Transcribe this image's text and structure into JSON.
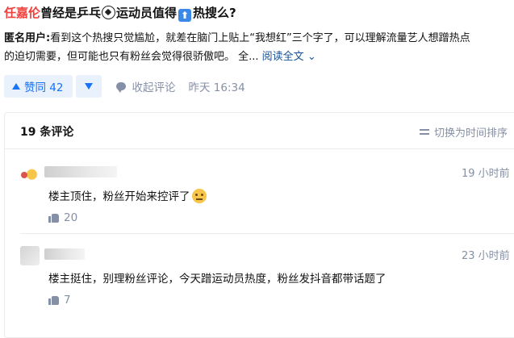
{
  "question": {
    "title_highlight": "任嘉伦",
    "title_part1": "曾经是乒乓",
    "icon_soccer": "soccer-ball-emoji",
    "title_part2": "运动员值得",
    "icon_up": "up-arrow-emoji",
    "title_part3": "热搜么?"
  },
  "answer": {
    "author": "匿名用户:",
    "text_line1": "看到这个热搜只觉尴尬，就差在脑门上贴上“我想红”三个字了，可以理解流量艺人想蹭热点",
    "text_line2": "的迫切需要，但可能也只有粉丝会觉得很骄傲吧。 全...",
    "read_more": "阅读全文",
    "read_more_icon": "chevron-down-icon"
  },
  "actions": {
    "upvote_label": "赞同 42",
    "collapse_label": "收起评论",
    "time": "昨天 16:34"
  },
  "comments": {
    "count_label": "19 条评论",
    "sort_label": "切换为时间排序",
    "items": [
      {
        "time": "19 小时前",
        "text": "楼主顶住，粉丝开始来控评了",
        "emoji": "thinking-face-emoji",
        "likes": "20"
      },
      {
        "time": "23 小时前",
        "text": "楼主挺住，别理粉丝评论，今天蹭运动员热度，粉丝发抖音都带话题了",
        "likes": "7"
      }
    ]
  },
  "colors": {
    "accent": "#1772f6",
    "highlight": "#f1403c",
    "muted": "#8590a6"
  }
}
